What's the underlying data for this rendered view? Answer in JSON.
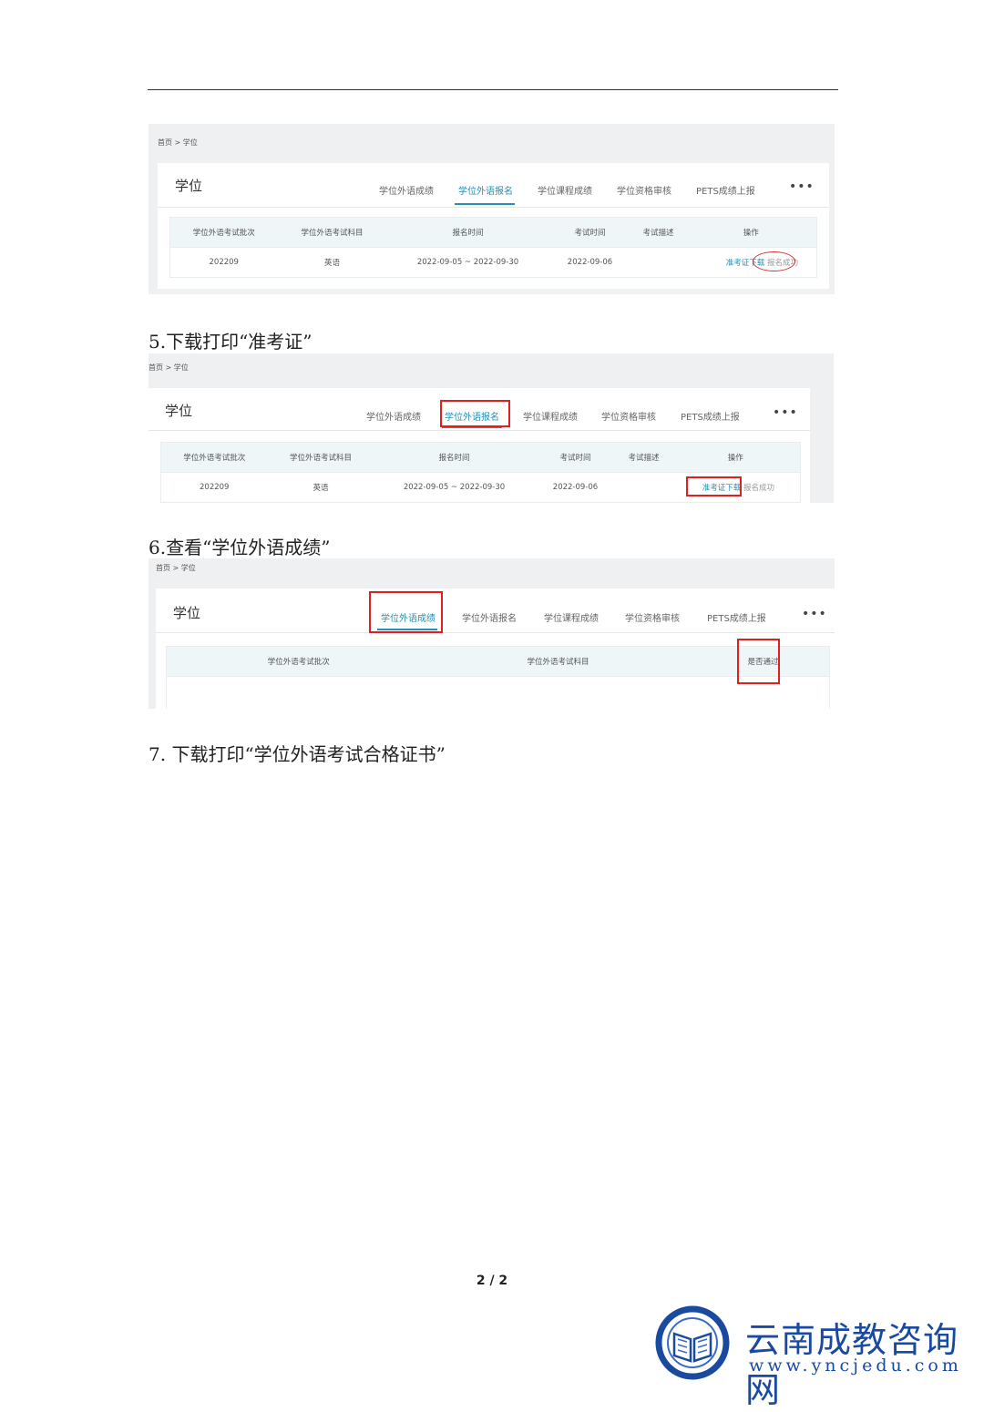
{
  "breadcrumb": "首页 > 学位",
  "card_title": "学位",
  "tabs": [
    "学位外语成绩",
    "学位外语报名",
    "学位课程成绩",
    "学位资格审核",
    "PETS成绩上报"
  ],
  "more": "•••",
  "reg_table": {
    "headers": [
      "学位外语考试批次",
      "学位外语考试科目",
      "报名时间",
      "考试时间",
      "考试描述",
      "操作"
    ],
    "row": {
      "batch": "202209",
      "subject": "英语",
      "reg_time": "2022-09-05 ~ 2022-09-30",
      "exam_time": "2022-09-06",
      "desc": "",
      "download": "准考证下载",
      "status": "报名成功"
    }
  },
  "score_table": {
    "headers": [
      "学位外语考试批次",
      "学位外语考试科目",
      "是否通过"
    ]
  },
  "steps": {
    "s5": "5.下载打印“准考证”",
    "s6": "6.查看“学位外语成绩”",
    "s7": "7.  下载打印“学位外语考试合格证书”"
  },
  "page_number": "2 / 2",
  "watermark": {
    "name": "云南成教咨询网",
    "url": "www.yncjedu.com"
  },
  "colors": {
    "accent": "#2a8fb0",
    "highlight": "#e02020",
    "brand": "#1a4aa0"
  }
}
